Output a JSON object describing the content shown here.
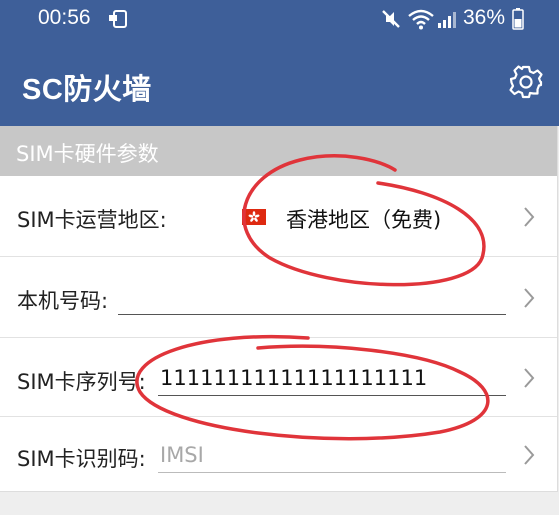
{
  "status_bar": {
    "time": "00:56",
    "battery_percent": "36%",
    "icons": [
      "notification-icon",
      "mute-icon",
      "wifi-icon",
      "signal-icon",
      "battery-icon"
    ]
  },
  "app_bar": {
    "title": "SC防火墙",
    "settings_icon": "gear-icon"
  },
  "section": {
    "header": "SIM卡硬件参数"
  },
  "rows": [
    {
      "label": "SIM卡运营地区:",
      "value": "香港地区（免费)",
      "flag": "hong-kong-flag-icon"
    },
    {
      "label": "本机号码:",
      "value": ""
    },
    {
      "label": "SIM卡序列号:",
      "value": "11111111111111111111"
    },
    {
      "label": "SIM卡识别码:",
      "placeholder": "IMSI",
      "value": ""
    }
  ],
  "colors": {
    "app_bar": "#3e5f99",
    "section_header": "#c7c7c7",
    "annotation": "#e0343a"
  }
}
